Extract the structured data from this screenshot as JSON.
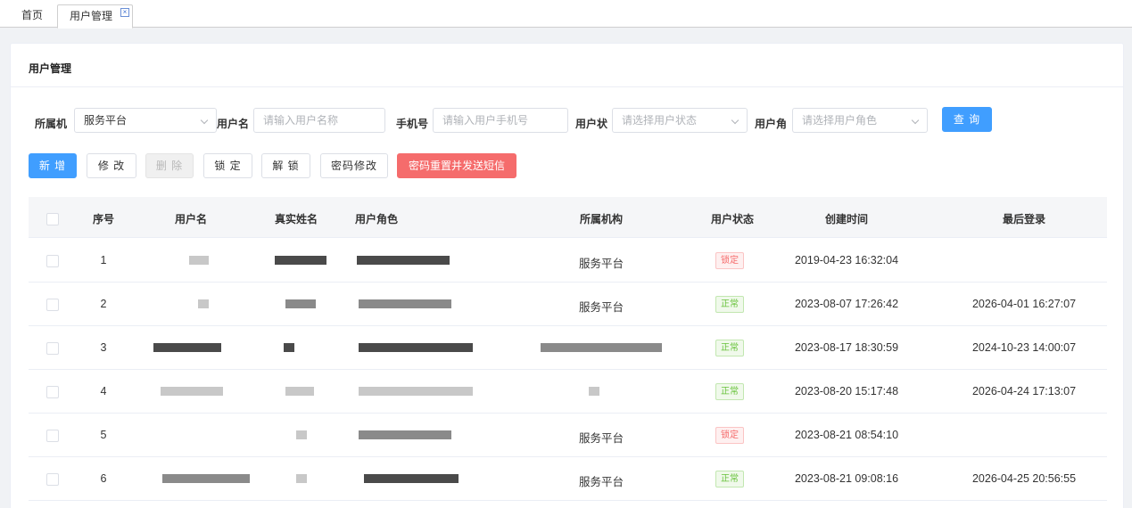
{
  "tabs": {
    "home": "首页",
    "active": "用户管理"
  },
  "panel": {
    "title": "用户管理"
  },
  "filters": {
    "org_label": "所属机",
    "org_value": "服务平台",
    "username_label": "用户名",
    "username_placeholder": "请输入用户名称",
    "phone_label": "手机号",
    "phone_placeholder": "请输入用户手机号",
    "status_label": "用户状",
    "status_placeholder": "请选择用户状态",
    "role_label": "用户角",
    "role_placeholder": "请选择用户角色",
    "query_label": "查 询"
  },
  "toolbar": {
    "add": "新 增",
    "edit": "修 改",
    "delete": "删 除",
    "lock": "锁 定",
    "unlock": "解 锁",
    "password": "密码修改",
    "reset_sms": "密码重置并发送短信"
  },
  "table": {
    "headers": {
      "index": "序号",
      "username": "用户名",
      "realname": "真实姓名",
      "role": "用户角色",
      "org": "所属机构",
      "status": "用户状态",
      "created": "创建时间",
      "lastlogin": "最后登录"
    },
    "rows": [
      {
        "index": "1",
        "org": "服务平台",
        "status": "锁定",
        "created": "2019-04-23 16:32:04",
        "lastlogin": ""
      },
      {
        "index": "2",
        "org": "服务平台",
        "status": "正常",
        "created": "2023-08-07 17:26:42",
        "lastlogin": "2026-04-01 16:27:07"
      },
      {
        "index": "3",
        "org": "",
        "status": "正常",
        "created": "2023-08-17 18:30:59",
        "lastlogin": "2024-10-23 14:00:07"
      },
      {
        "index": "4",
        "org": "",
        "status": "正常",
        "created": "2023-08-20 15:17:48",
        "lastlogin": "2026-04-24 17:13:07"
      },
      {
        "index": "5",
        "org": "服务平台",
        "status": "锁定",
        "created": "2023-08-21 08:54:10",
        "lastlogin": ""
      },
      {
        "index": "6",
        "org": "服务平台",
        "status": "正常",
        "created": "2023-08-21 09:08:16",
        "lastlogin": "2026-04-25 20:56:55"
      }
    ]
  },
  "colors": {
    "primary": "#409eff",
    "danger": "#f56c6c",
    "success": "#67c23a"
  }
}
